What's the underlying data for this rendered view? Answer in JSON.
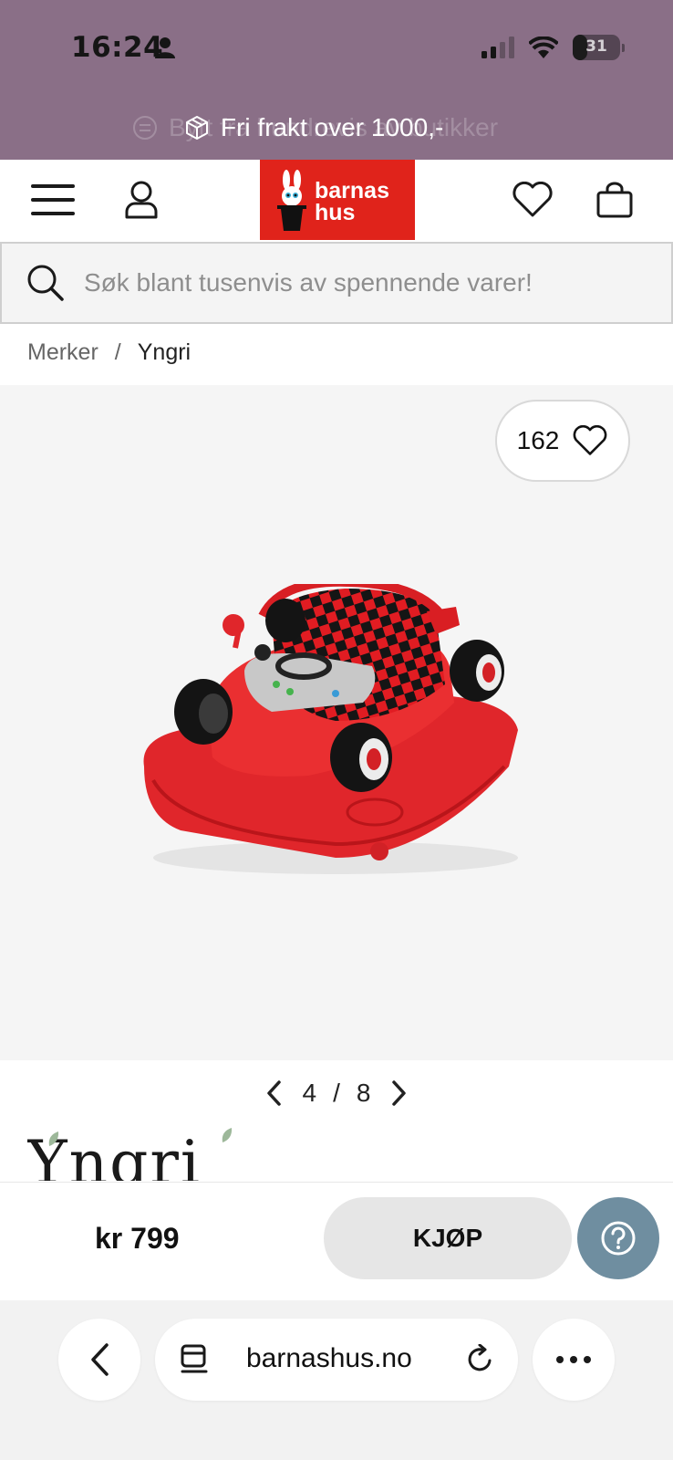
{
  "status_bar": {
    "time": "16:24",
    "battery": "31",
    "battery_level": 0.31
  },
  "promo": {
    "text": "Fri frakt over 1000,-",
    "ghost_text": "Bytt fra  hundrevis av butikker"
  },
  "header": {
    "logo_line1": "barnas",
    "logo_line2": "hus"
  },
  "search": {
    "placeholder": "Søk blant tusenvis av spennende varer!"
  },
  "breadcrumb": {
    "items": [
      "Merker",
      "Yngri"
    ],
    "separator": "/"
  },
  "product": {
    "favorites_count": "162",
    "pager_current": "4",
    "pager_separator": "/",
    "pager_total": "8",
    "brand": "Yngri"
  },
  "buy_bar": {
    "price": "kr 799",
    "buy_label": "KJØP"
  },
  "browser": {
    "url": "barnashus.no"
  },
  "colors": {
    "banner": "#8a6f87",
    "logo": "#e0231b",
    "help": "#6f8ea0"
  }
}
